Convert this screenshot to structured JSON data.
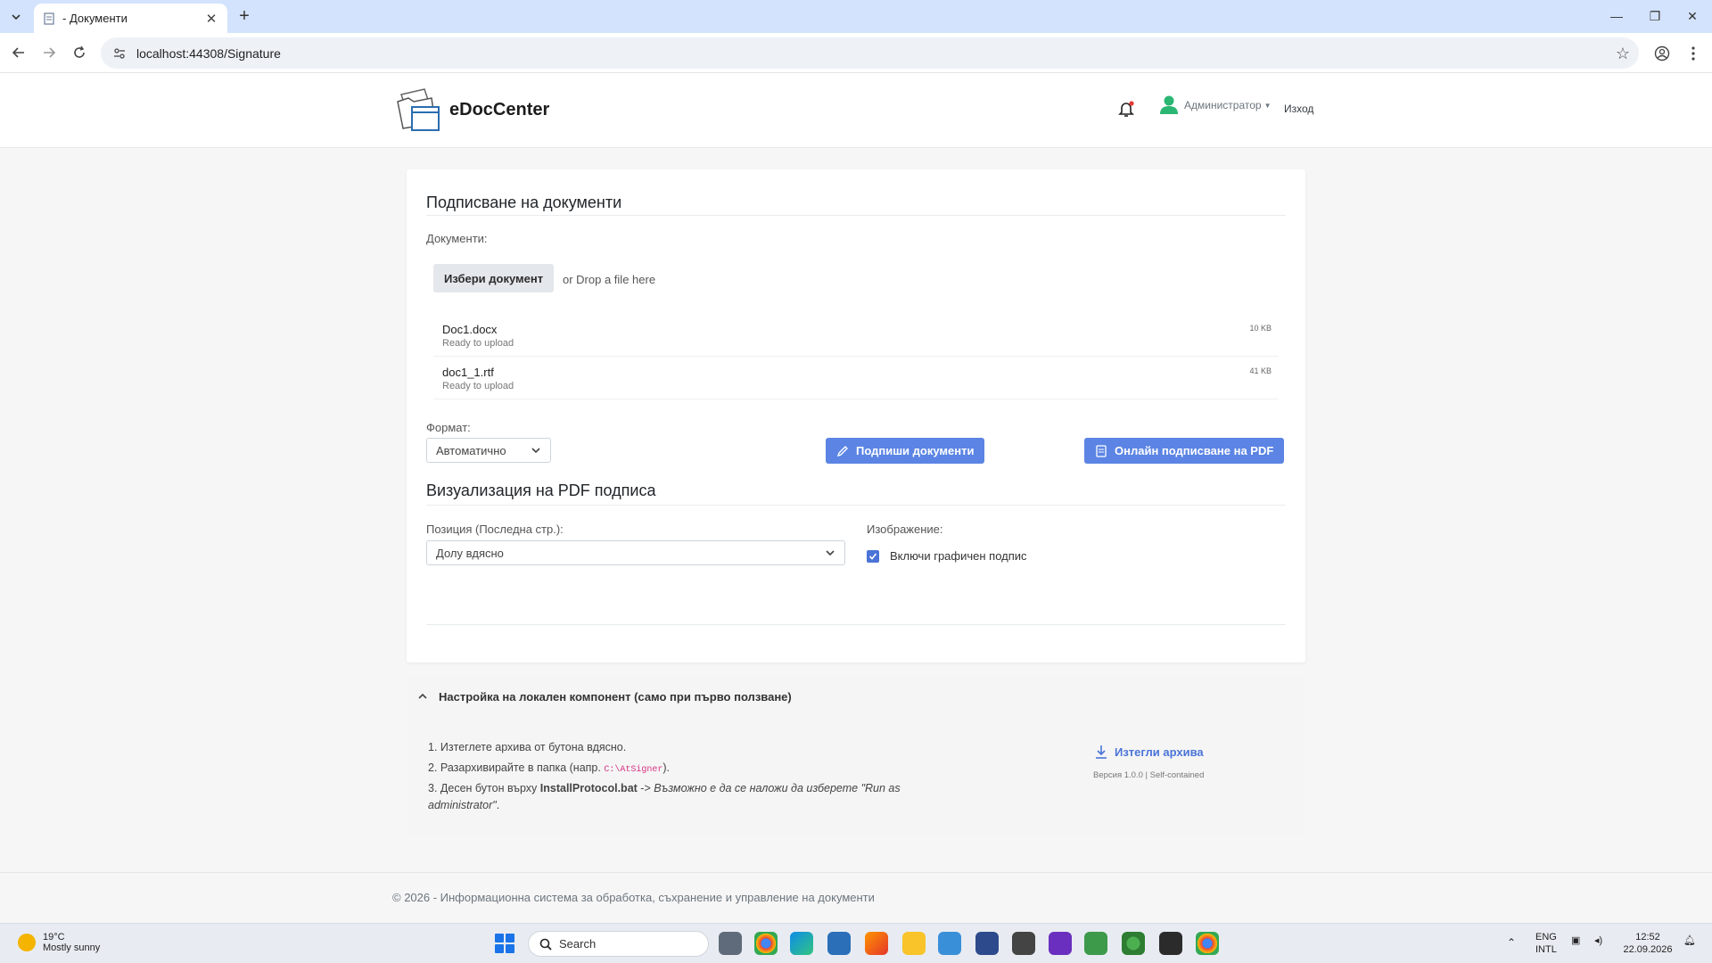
{
  "browser": {
    "tab_title": "- Документи",
    "url": "localhost:44308/Signature"
  },
  "header": {
    "logo_text": "eDocCenter",
    "user_name": "Администратор",
    "logout": "Изход"
  },
  "card": {
    "title": "Подписване на документи",
    "documents_label": "Документи:",
    "choose_button": "Избери документ",
    "drop_text": "or Drop a file here",
    "files": [
      {
        "name": "Doc1.docx",
        "status": "Ready to upload",
        "size": "10 KB"
      },
      {
        "name": "doc1_1.rtf",
        "status": "Ready to upload",
        "size": "41 KB"
      }
    ],
    "format_label": "Формат:",
    "format_value": "Автоматично",
    "sign_button": "Подпиши документи",
    "online_pdf_button": "Онлайн подписване на PDF",
    "viz_title": "Визуализация на PDF подписа",
    "position_label": "Позиция (Последна стр.):",
    "position_value": "Долу вдясно",
    "image_label": "Изображение:",
    "include_graphic": "Включи графичен подпис",
    "include_graphic_checked": true
  },
  "setup": {
    "title": "Настройка на локален компонент (само при първо ползване)",
    "step1": "1. Изтеглете архива от бутона вдясно.",
    "step2_pre": "2. Разархивирайте в папка (напр. ",
    "step2_code": "C:\\AtSigner",
    "step2_post": ").",
    "step3_pre": "3. Десен бутон върху ",
    "step3_bold": "InstallProtocol.bat",
    "step3_arrow": " -> ",
    "step3_italic": "Възможно е да се наложи да изберете \"Run as administrator\"",
    "step3_end": ".",
    "download_label": "Изтегли архива",
    "version": "Версия 1.0.0 | Self-contained"
  },
  "footer": {
    "text": "© 2026 - Информационна система за обработка, съхранение и управление на документи"
  },
  "taskbar": {
    "temperature": "19°C",
    "weather": "Mostly sunny",
    "search_placeholder": "Search",
    "lang1": "ENG",
    "lang2": "INTL",
    "time": "12:52",
    "date": "22.09.2026"
  },
  "colors": {
    "accent": "#5b84e4",
    "link": "#4a74d8",
    "user_icon": "#2bb673"
  }
}
